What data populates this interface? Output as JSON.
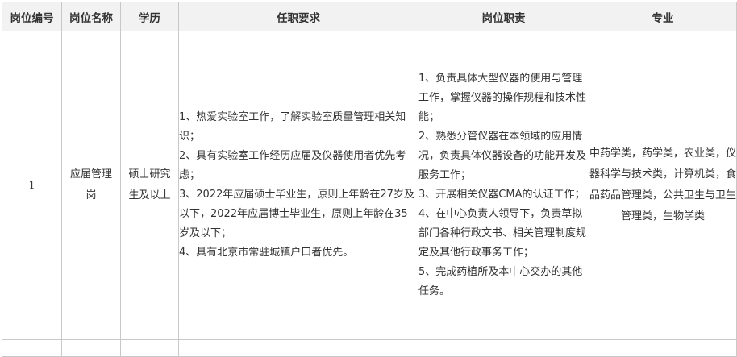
{
  "table": {
    "headers": [
      "岗位编号",
      "岗位名称",
      "学历",
      "任职要求",
      "岗位职责",
      "专业"
    ],
    "row": {
      "id": "1",
      "name": "应届管理岗",
      "education": "硕士研究生及以上",
      "requirements": [
        "1、热爱实验室工作，了解实验室质量管理相关知识；",
        "2、具有实验室工作经历应届及仪器使用者优先考虑；",
        "3、2022年应届硕士毕业生，原则上年龄在27岁及以下，2022年应届博士毕业生，原则上年龄在35岁及以下；",
        "4、具有北京市常驻城镇户口者优先。"
      ],
      "duties": [
        "1、负责具体大型仪器的使用与管理工作，掌握仪器的操作规程和技术性能；",
        "2、熟悉分管仪器在本领域的应用情况，负责具体仪器设备的功能开发及服务工作；",
        "3、开展相关仪器CMA的认证工作；",
        "4、在中心负责人领导下，负责草拟部门各种行政文书、相关管理制度规定及其他行政事务工作；",
        "5、完成药植所及本中心交办的其他任务。"
      ],
      "major": "中药学类，药学类，农业类，仪器科学与技术类，计算机类，食品药品管理类，公共卫生与卫生管理类，生物学类"
    }
  }
}
